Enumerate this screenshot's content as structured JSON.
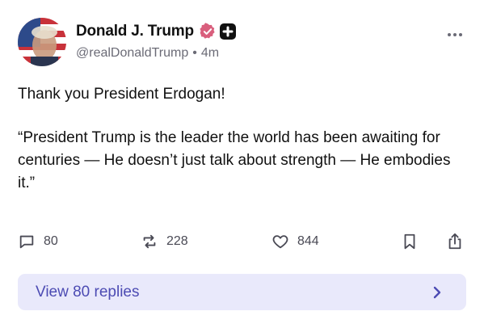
{
  "post": {
    "author": {
      "display_name": "Donald J. Trump",
      "handle": "@realDonaldTrump",
      "separator": "•",
      "time_ago": "4m",
      "verified_color": "#d95f7d",
      "badge_icon": "plus-badge-icon"
    },
    "body": {
      "paragraph_1": "Thank you President Erdogan!",
      "paragraph_2": "“President Trump is the leader the world has been awaiting for centuries — He doesn’t just talk about strength — He embodies it.”"
    },
    "actions": {
      "replies_count": "80",
      "reposts_count": "228",
      "likes_count": "844"
    },
    "view_replies_label": "View 80 replies"
  },
  "colors": {
    "accent": "#4c4bb3",
    "replies_bar_bg": "#e9e9fb",
    "muted_text": "#6b6b76"
  }
}
